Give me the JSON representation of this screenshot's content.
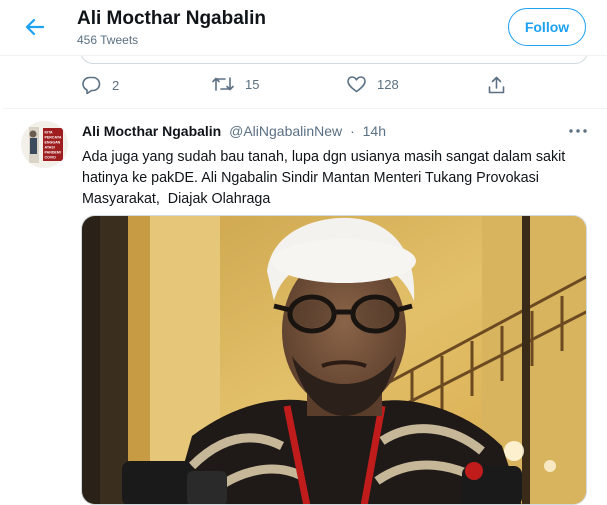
{
  "header": {
    "title": "Ali Mocthar Ngabalin",
    "tweet_count": "456 Tweets",
    "follow_label": "Follow",
    "back_icon": "arrow-left-icon"
  },
  "previous_tweet_actions": {
    "reply_count": "2",
    "retweet_count": "15",
    "like_count": "128"
  },
  "tweet": {
    "author_name": "Ali Mocthar Ngabalin",
    "author_handle": "@AliNgabalinNew",
    "separator": "·",
    "time": "14h",
    "text_lines": [
      "Ada juga yang sudah bau tanah, lupa dgn usianya masih sangat dalam sakit",
      "hatinya ke pakDE. Ali Ngabalin Sindir Mantan Menteri Tukang Provokasi",
      "Masyarakat,  Diajak Olahraga"
    ],
    "avatar_text": [
      "KITA",
      "PERCAYA",
      "ENGGAN",
      "ATASI",
      "PANDEMI",
      "COVID"
    ]
  },
  "colors": {
    "accent": "#1da1f2",
    "secondary_text": "#5b7083",
    "avatar_red": "#9e1d1f"
  }
}
